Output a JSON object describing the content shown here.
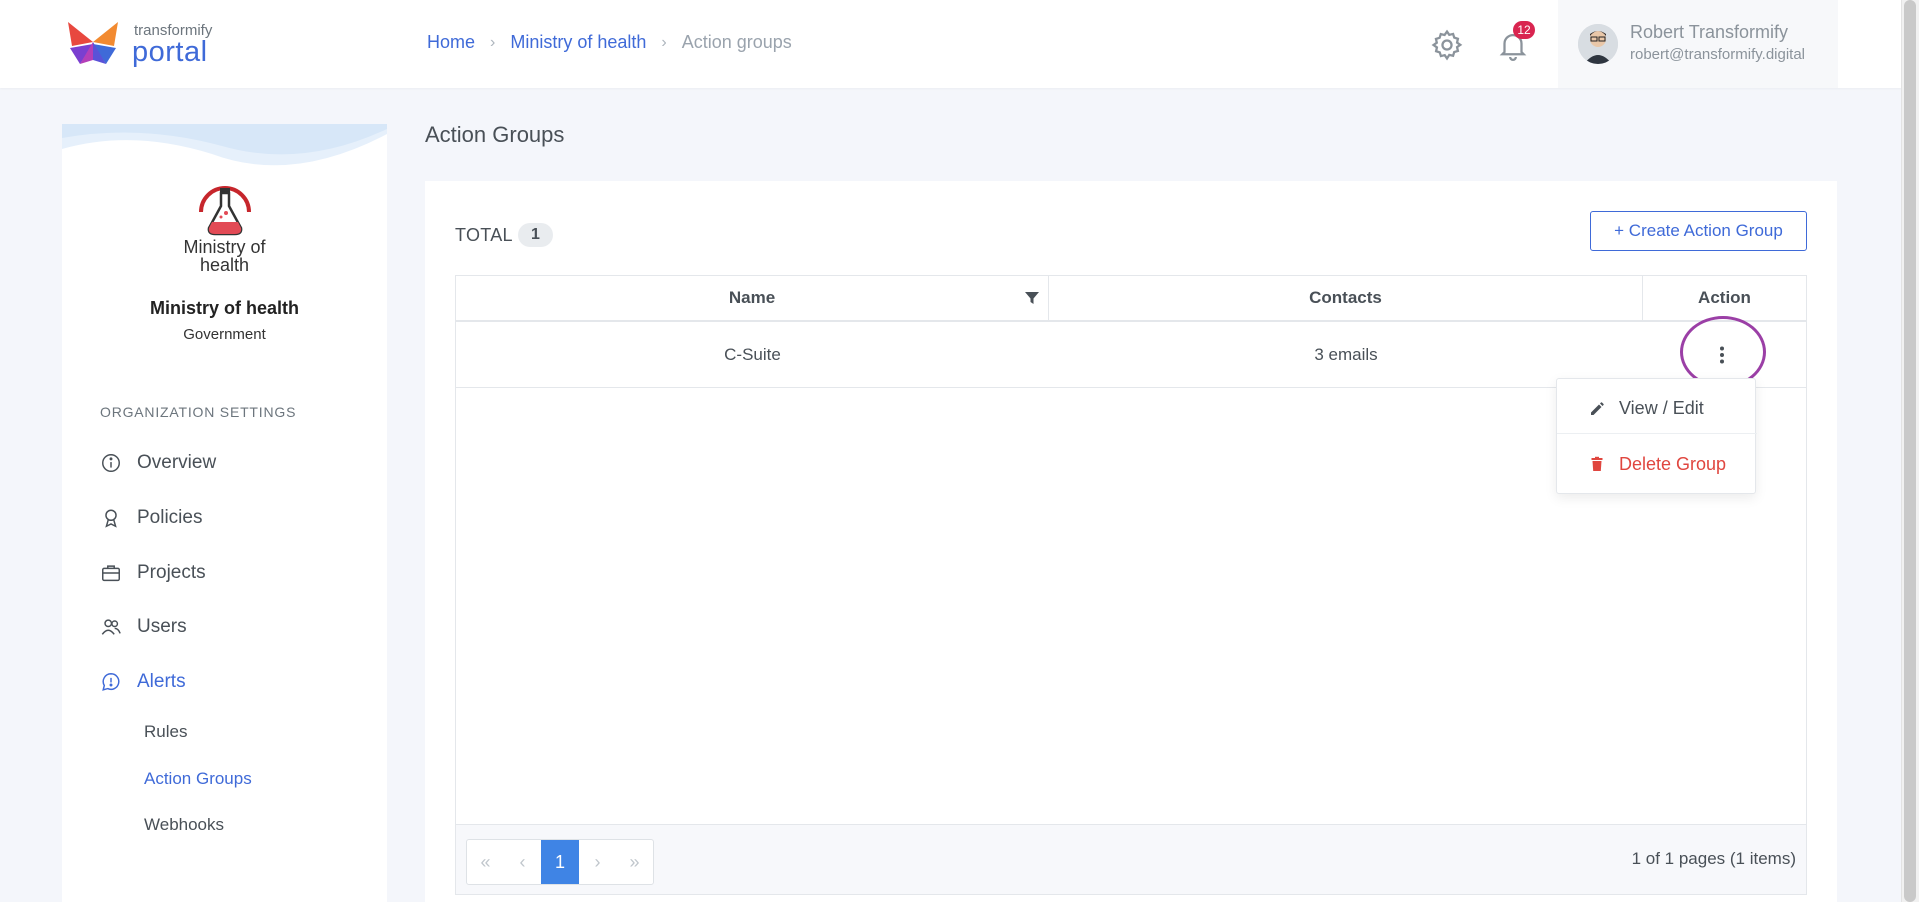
{
  "brand": {
    "top_text": "transformify",
    "main_text": "portal"
  },
  "breadcrumb": {
    "home": "Home",
    "org": "Ministry of health",
    "current": "Action groups"
  },
  "header": {
    "notifications_count": "12",
    "user_name": "Robert Transformify",
    "user_email": "robert@transformify.digital"
  },
  "sidebar": {
    "org_logo_text": "Ministry of health",
    "org_name": "Ministry of health",
    "org_type": "Government",
    "section_heading": "ORGANIZATION SETTINGS",
    "items": [
      {
        "label": "Overview",
        "icon": "info-icon"
      },
      {
        "label": "Policies",
        "icon": "ribbon-icon"
      },
      {
        "label": "Projects",
        "icon": "briefcase-icon"
      },
      {
        "label": "Users",
        "icon": "users-icon"
      },
      {
        "label": "Alerts",
        "icon": "chat-alert-icon"
      }
    ],
    "sub_items": [
      "Rules",
      "Action Groups",
      "Webhooks"
    ]
  },
  "main": {
    "page_title": "Action Groups",
    "total_label": "TOTAL",
    "total_count": "1",
    "create_button": "+ Create Action Group",
    "columns": [
      "Name",
      "Contacts",
      "Action"
    ],
    "rows": [
      {
        "name": "C-Suite",
        "contacts": "3 emails"
      }
    ],
    "pager_current": "1",
    "pager_info": "1 of 1 pages (1 items)"
  },
  "dropdown": {
    "edit": "View / Edit",
    "delete": "Delete Group"
  },
  "colors": {
    "accent": "#3f6ad8",
    "danger": "#e0463f",
    "badge": "#d92550",
    "highlight": "#9b3fa6"
  }
}
